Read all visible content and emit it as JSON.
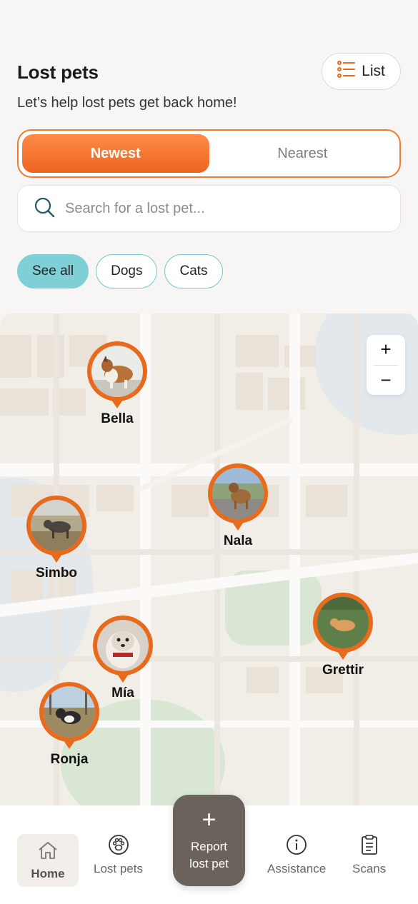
{
  "header": {
    "title": "Lost pets",
    "list_label": "List",
    "subtitle": "Let’s help lost pets get back home!"
  },
  "sort_tabs": {
    "newest": "Newest",
    "nearest": "Nearest",
    "selected": "Newest"
  },
  "search": {
    "placeholder": "Search for a lost pet...",
    "value": ""
  },
  "filters": {
    "see_all": "See all",
    "dogs": "Dogs",
    "cats": "Cats",
    "selected": "See all"
  },
  "map": {
    "zoom_in": "+",
    "zoom_out": "−",
    "pets": [
      {
        "name": "Bella",
        "icon": "collie-dog-photo"
      },
      {
        "name": "Nala",
        "icon": "brown-dog-photo"
      },
      {
        "name": "Simbo",
        "icon": "tabby-cat-photo"
      },
      {
        "name": "Grettir",
        "icon": "ginger-cat-photo"
      },
      {
        "name": "Mía",
        "icon": "shih-tzu-dog-photo"
      },
      {
        "name": "Ronja",
        "icon": "bulldog-photo"
      }
    ]
  },
  "nav": {
    "home": "Home",
    "lost_pets": "Lost pets",
    "report_line1": "Report",
    "report_line2": "lost pet",
    "report_plus": "+",
    "assistance": "Assistance",
    "scans": "Scans",
    "active": "Home"
  },
  "colors": {
    "accent_orange": "#ec6520",
    "teal": "#7ed0d6",
    "report_button": "#6b625c",
    "background": "#f8f6f4"
  }
}
